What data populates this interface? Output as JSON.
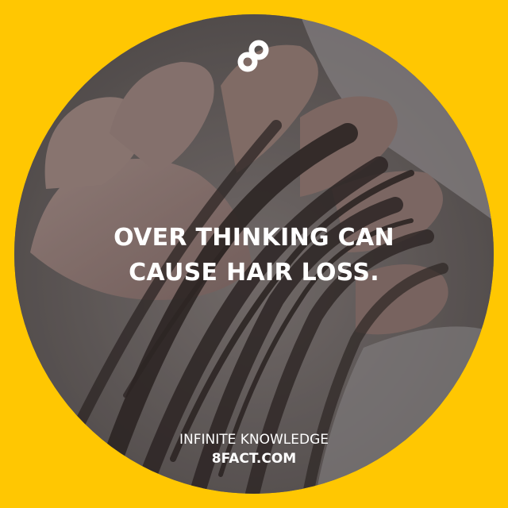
{
  "brand": {
    "logo_icon": "infinity-8-logo-icon",
    "background_color": "#ffc702",
    "text_color": "#ffffff"
  },
  "headline": {
    "line1": "OVER THINKING CAN",
    "line2": "CAUSE HAIR LOSS."
  },
  "footer": {
    "tagline": "INFINITE KNOWLEDGE",
    "site": "8FACT.COM"
  },
  "photo": {
    "subject_icon": "hand-holding-hair-image"
  }
}
